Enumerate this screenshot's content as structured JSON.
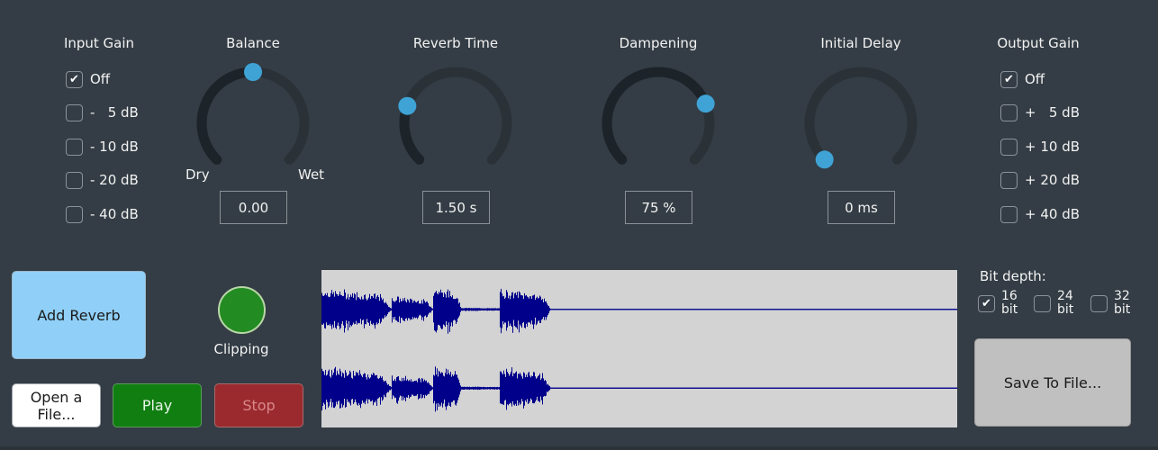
{
  "input_gain": {
    "title": "Input Gain",
    "options": [
      {
        "label": "Off",
        "checked": true
      },
      {
        "label": "-   5 dB",
        "checked": false
      },
      {
        "label": "- 10 dB",
        "checked": false
      },
      {
        "label": "- 20 dB",
        "checked": false
      },
      {
        "label": "- 40 dB",
        "checked": false
      }
    ]
  },
  "output_gain": {
    "title": "Output Gain",
    "options": [
      {
        "label": "Off",
        "checked": true
      },
      {
        "label": "+   5 dB",
        "checked": false
      },
      {
        "label": "+ 10 dB",
        "checked": false
      },
      {
        "label": "+ 20 dB",
        "checked": false
      },
      {
        "label": "+ 40 dB",
        "checked": false
      }
    ]
  },
  "knobs": [
    {
      "id": "balance",
      "title": "Balance",
      "value_text": "0.00",
      "fraction": 0.5,
      "min_label": "Dry",
      "max_label": "Wet"
    },
    {
      "id": "reverb-time",
      "title": "Reverb Time",
      "value_text": "1.50 s",
      "fraction": 0.24
    },
    {
      "id": "dampening",
      "title": "Dampening",
      "value_text": "75 %",
      "fraction": 0.75
    },
    {
      "id": "initial-delay",
      "title": "Initial Delay",
      "value_text": "0 ms",
      "fraction": 0.0
    }
  ],
  "buttons": {
    "add_reverb": "Add Reverb",
    "open_file_line1": "Open a",
    "open_file_line2": "File...",
    "play": "Play",
    "stop": "Stop",
    "save": "Save To File..."
  },
  "clipping": {
    "label": "Clipping",
    "color": "#228b22"
  },
  "bit_depth": {
    "title": "Bit depth:",
    "options": [
      {
        "num": "16",
        "unit": "bit",
        "checked": true
      },
      {
        "num": "24",
        "unit": "bit",
        "checked": false
      },
      {
        "num": "32",
        "unit": "bit",
        "checked": false
      }
    ]
  },
  "colors": {
    "background": "#343d45",
    "knob_thumb": "#3fa3d6",
    "knob_fill": "#1c2329",
    "knob_track": "#2a3238",
    "waveform": "#00008b",
    "waveform_bg": "#d3d3d3",
    "add_reverb_bg": "#90d0f8",
    "play_bg": "#117e11",
    "stop_bg": "#9b2a2e",
    "save_bg": "#c0c0c0"
  },
  "waveform": {
    "channels": 2,
    "segments": [
      {
        "start": 0.0,
        "end": 0.11,
        "amp": 0.9
      },
      {
        "start": 0.11,
        "end": 0.175,
        "amp": 0.55
      },
      {
        "start": 0.175,
        "end": 0.22,
        "amp": 1.0
      },
      {
        "start": 0.22,
        "end": 0.28,
        "amp": 0.05
      },
      {
        "start": 0.28,
        "end": 0.36,
        "amp": 0.9
      },
      {
        "start": 0.36,
        "end": 1.0,
        "amp": 0.0
      }
    ]
  }
}
